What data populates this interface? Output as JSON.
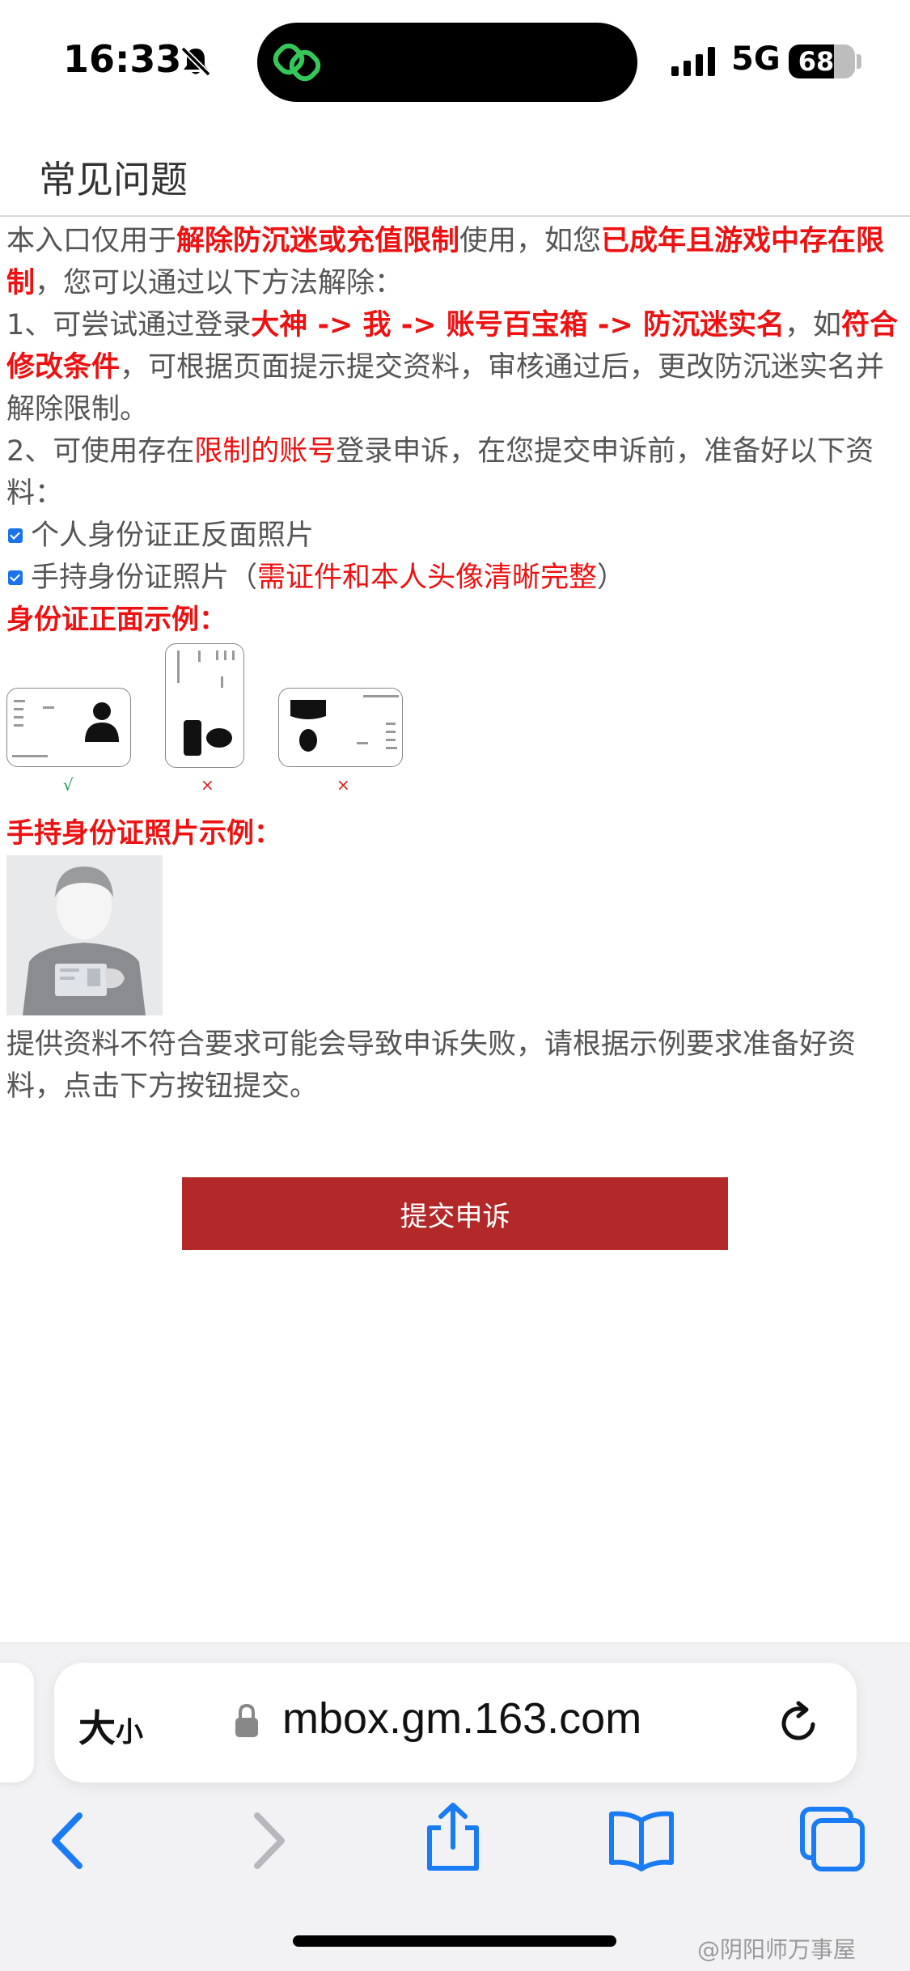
{
  "status": {
    "time": "16:33",
    "network": "5G",
    "battery": "68",
    "battery_level": 0.68
  },
  "header": {
    "title": "常见问题"
  },
  "intro": {
    "t1": "本入口仅用于",
    "t2": "解除防沉迷或充值限制",
    "t3": "使用，如您",
    "t4": "已成年且游戏中存在限制",
    "t5": "，您可以通过以下方法解除："
  },
  "method1": {
    "t1": "1、可尝试通过登录",
    "t2": "大神 -> 我 -> 账号百宝箱 -> 防沉迷实名",
    "t3": "，如",
    "t4": "符合修改条件",
    "t5": "，可根据页面提示提交资料，审核通过后，更改防沉迷实名并解除限制。"
  },
  "method2": {
    "t1": "2、可使用存在",
    "t2": "限制的账号",
    "t3": "登录申诉，在您提交申诉前，准备好以下资料："
  },
  "checklist": {
    "item1": "个人身份证正反面照片",
    "item2_a": "手持身份证照片（",
    "item2_b": "需证件和本人头像清晰完整",
    "item2_c": "）"
  },
  "id_section": {
    "title": "身份证正面示例：",
    "marks": [
      "√",
      "×",
      "×"
    ]
  },
  "hold_section": {
    "title": "手持身份证照片示例："
  },
  "notice": "提供资料不符合要求可能会导致申诉失败，请根据示例要求准备好资料，点击下方按钮提交。",
  "submit_label": "提交申诉",
  "browser": {
    "text_size_a": "大",
    "text_size_b": "小",
    "url": "mbox.gm.163.com"
  },
  "watermark": "@阴阳师万事屋",
  "colors": {
    "accent_red": "#ee1111",
    "button_red": "#b32828",
    "ios_blue": "#1a7cf5"
  },
  "icons": [
    "bell-slash-icon",
    "link-app-icon",
    "signal-icon",
    "battery-icon",
    "lock-icon",
    "reload-icon",
    "back-icon",
    "forward-icon",
    "share-icon",
    "bookmarks-icon",
    "tabs-icon"
  ]
}
